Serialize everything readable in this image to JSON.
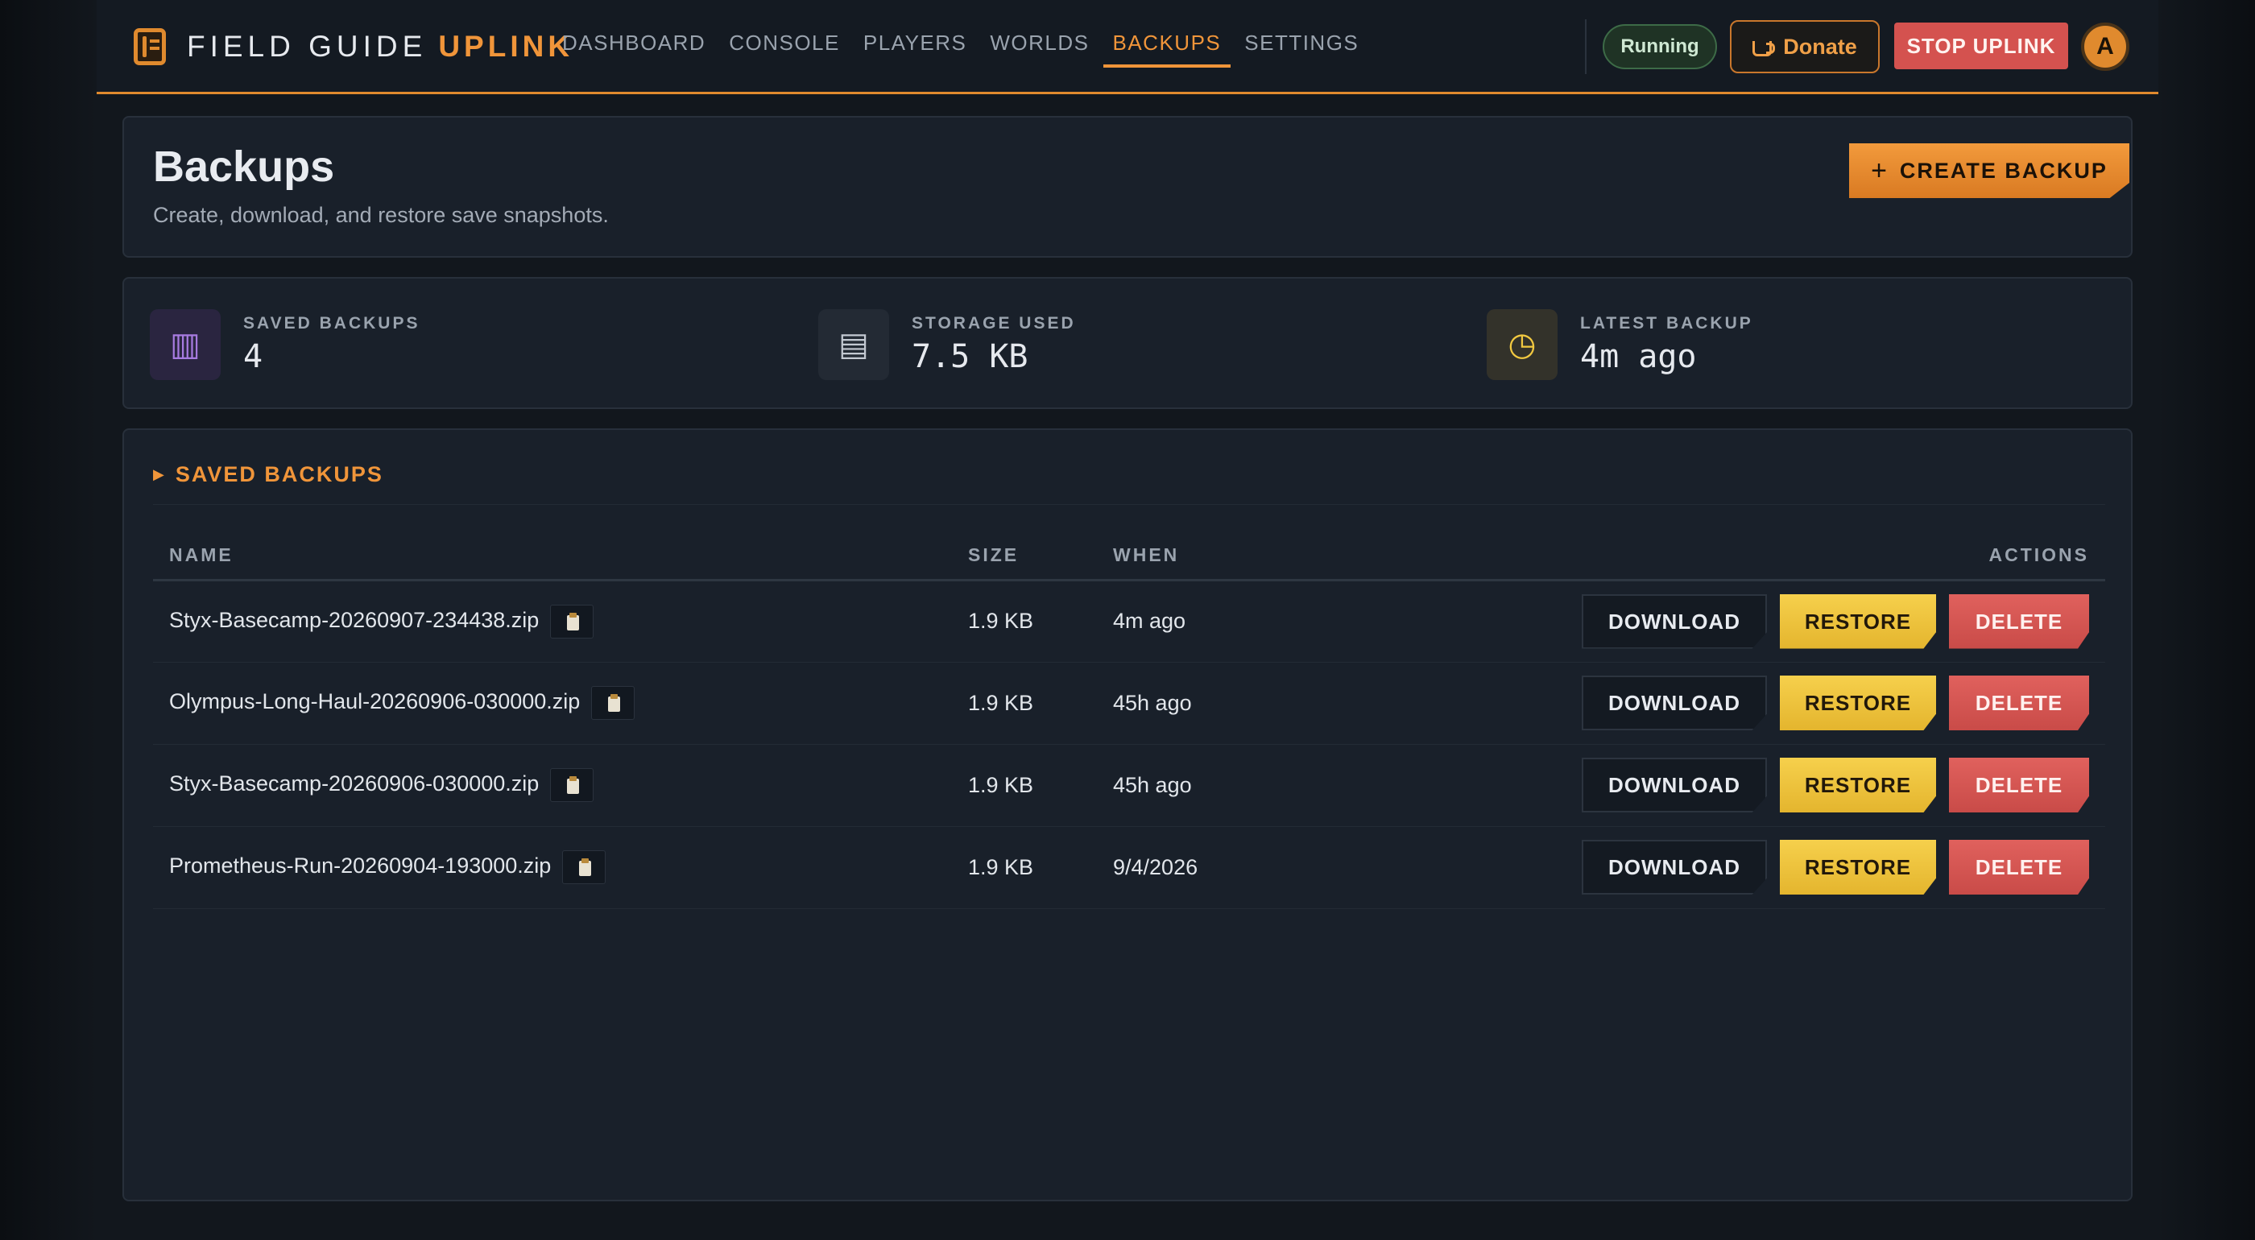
{
  "brand": {
    "name": "FIELD GUIDE",
    "accent": "UPLINK",
    "icon": "book-icon"
  },
  "nav": {
    "items": [
      {
        "label": "DASHBOARD",
        "active": false
      },
      {
        "label": "CONSOLE",
        "active": false
      },
      {
        "label": "PLAYERS",
        "active": false
      },
      {
        "label": "WORLDS",
        "active": false
      },
      {
        "label": "BACKUPS",
        "active": true
      },
      {
        "label": "SETTINGS",
        "active": false
      }
    ]
  },
  "topbar": {
    "status": "Running",
    "donate_label": "Donate",
    "donate_icon": "coffee-cup-icon",
    "stop_label": "STOP UPLINK",
    "avatar_initial": "A"
  },
  "header": {
    "title": "Backups",
    "subtitle": "Create, download, and restore save snapshots.",
    "create_label": "CREATE BACKUP",
    "create_icon": "plus-icon"
  },
  "stats": [
    {
      "label": "SAVED BACKUPS",
      "value": "4",
      "icon": "archive-icon",
      "glyph": "▥",
      "icon_color": "#a77be0",
      "icon_bg": "#2a2540"
    },
    {
      "label": "STORAGE USED",
      "value": "7.5 KB",
      "icon": "storage-icon",
      "glyph": "▤",
      "icon_color": "#c3c9d2",
      "icon_bg": "#232a34"
    },
    {
      "label": "LATEST BACKUP",
      "value": "4m ago",
      "icon": "clock-icon",
      "glyph": "◷",
      "icon_color": "#f2c940",
      "icon_bg": "#33322a"
    }
  ],
  "section": {
    "title": "SAVED BACKUPS",
    "icon": "triangle-right-icon"
  },
  "table": {
    "columns": {
      "name": "NAME",
      "size": "SIZE",
      "when": "WHEN",
      "actions": "ACTIONS"
    },
    "rows": [
      {
        "name": "Styx-Basecamp-20260907-234438.zip",
        "size": "1.9 KB",
        "when": "4m ago"
      },
      {
        "name": "Olympus-Long-Haul-20260906-030000.zip",
        "size": "1.9 KB",
        "when": "45h ago"
      },
      {
        "name": "Styx-Basecamp-20260906-030000.zip",
        "size": "1.9 KB",
        "when": "45h ago"
      },
      {
        "name": "Prometheus-Run-20260904-193000.zip",
        "size": "1.9 KB",
        "when": "9/4/2026"
      }
    ],
    "actions": {
      "download": "DOWNLOAD",
      "restore": "RESTORE",
      "delete": "DELETE"
    }
  },
  "colors": {
    "accent": "#f0953a",
    "restore": "#f2c940",
    "delete": "#d4524f",
    "running": "#3d6b47"
  }
}
